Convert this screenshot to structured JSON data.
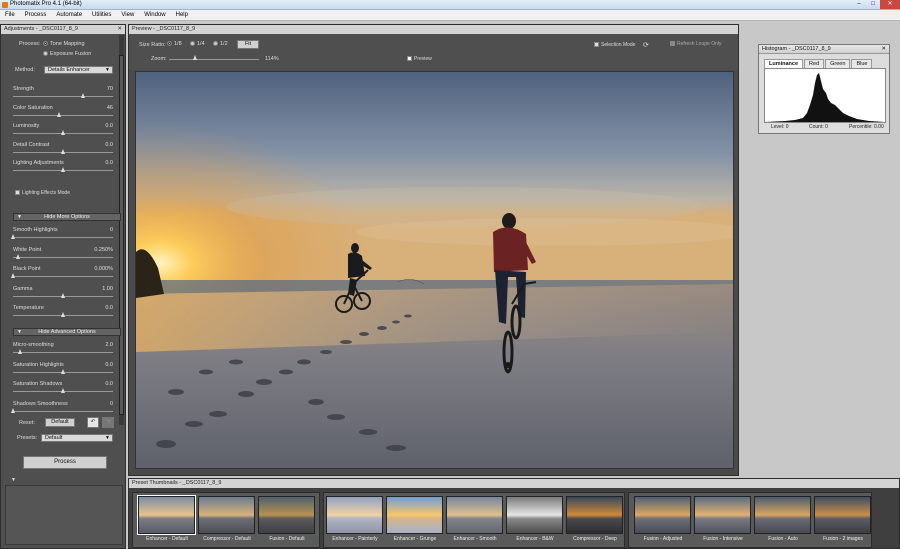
{
  "window": {
    "title": "Photomatix Pro 4.1 (64-bit)",
    "min": "–",
    "max": "□",
    "close": "✕"
  },
  "menu": [
    "File",
    "Process",
    "Automate",
    "Utilities",
    "View",
    "Window",
    "Help"
  ],
  "adjustments": {
    "title": "Adjustments - _DSC0117_8_9",
    "process_label": "Process:",
    "process_options": [
      "Tone Mapping",
      "Exposure Fusion"
    ],
    "method_label": "Method:",
    "method_value": "Details Enhancer",
    "sliders_main": [
      {
        "label": "Strength",
        "value": "70",
        "pos": 0.7
      },
      {
        "label": "Color Saturation",
        "value": "46",
        "pos": 0.46
      },
      {
        "label": "Luminosity",
        "value": "0.0",
        "pos": 0.5
      },
      {
        "label": "Detail Contrast",
        "value": "0.0",
        "pos": 0.5
      },
      {
        "label": "Lighting Adjustments",
        "value": "0.0",
        "pos": 0.5
      }
    ],
    "lighting_effects_mode": "Lighting Effects Mode",
    "hide_more_options": "Hide More Options",
    "sliders_more": [
      {
        "label": "Smooth Highlights",
        "value": "0",
        "pos": 0.0
      },
      {
        "label": "White Point",
        "value": "0.250%",
        "pos": 0.05
      },
      {
        "label": "Black Point",
        "value": "0.000%",
        "pos": 0.0
      },
      {
        "label": "Gamma",
        "value": "1.00",
        "pos": 0.5
      },
      {
        "label": "Temperature",
        "value": "0.0",
        "pos": 0.5
      }
    ],
    "hide_advanced_options": "Hide Advanced Options",
    "sliders_advanced": [
      {
        "label": "Micro-smoothing",
        "value": "2.0",
        "pos": 0.07
      },
      {
        "label": "Saturation Highlights",
        "value": "0.0",
        "pos": 0.5
      },
      {
        "label": "Saturation Shadows",
        "value": "0.0",
        "pos": 0.5
      },
      {
        "label": "Shadows Smoothness",
        "value": "0",
        "pos": 0.0
      }
    ],
    "reset_label": "Reset:",
    "reset_button": "Default",
    "presets_label": "Presets:",
    "presets_value": "Default",
    "process_button": "Process"
  },
  "preview": {
    "title": "Preview - _DSC0117_8_9",
    "size_ratio_label": "Size Ratio:",
    "size_options": [
      "1/8",
      "1/4",
      "1/2"
    ],
    "fit_button": "Fit",
    "zoom_label": "Zoom:",
    "zoom_value": "114%",
    "preview_check": "Preview",
    "selection_mode": "Selection Mode",
    "refresh_loupe": "Refresh Loupe Only"
  },
  "histogram": {
    "title": "Histogram - _DSC0117_8_9",
    "tabs": [
      "Luminance",
      "Red",
      "Green",
      "Blue"
    ],
    "level": "Level: 0",
    "count": "Count: 0",
    "percentile": "Percentile: 0.00"
  },
  "thumbnails": {
    "title": "Preset Thumbnails - _DSC0117_8_9",
    "items": [
      "Enhancer - Default",
      "Compressor - Default",
      "Fusion - Default",
      "Enhancer - Painterly",
      "Enhancer - Grunge",
      "Enhancer - Smooth",
      "Enhancer - B&W",
      "Compressor - Deep",
      "Fusion - Adjusted",
      "Fusion - Intensive",
      "Fusion - Auto",
      "Fusion - 2 images"
    ]
  },
  "colors": {
    "panel": "#4f4f4f",
    "sky_top": "#5d6f88",
    "sun": "#ffcc55",
    "sand": "#7d7f86"
  }
}
